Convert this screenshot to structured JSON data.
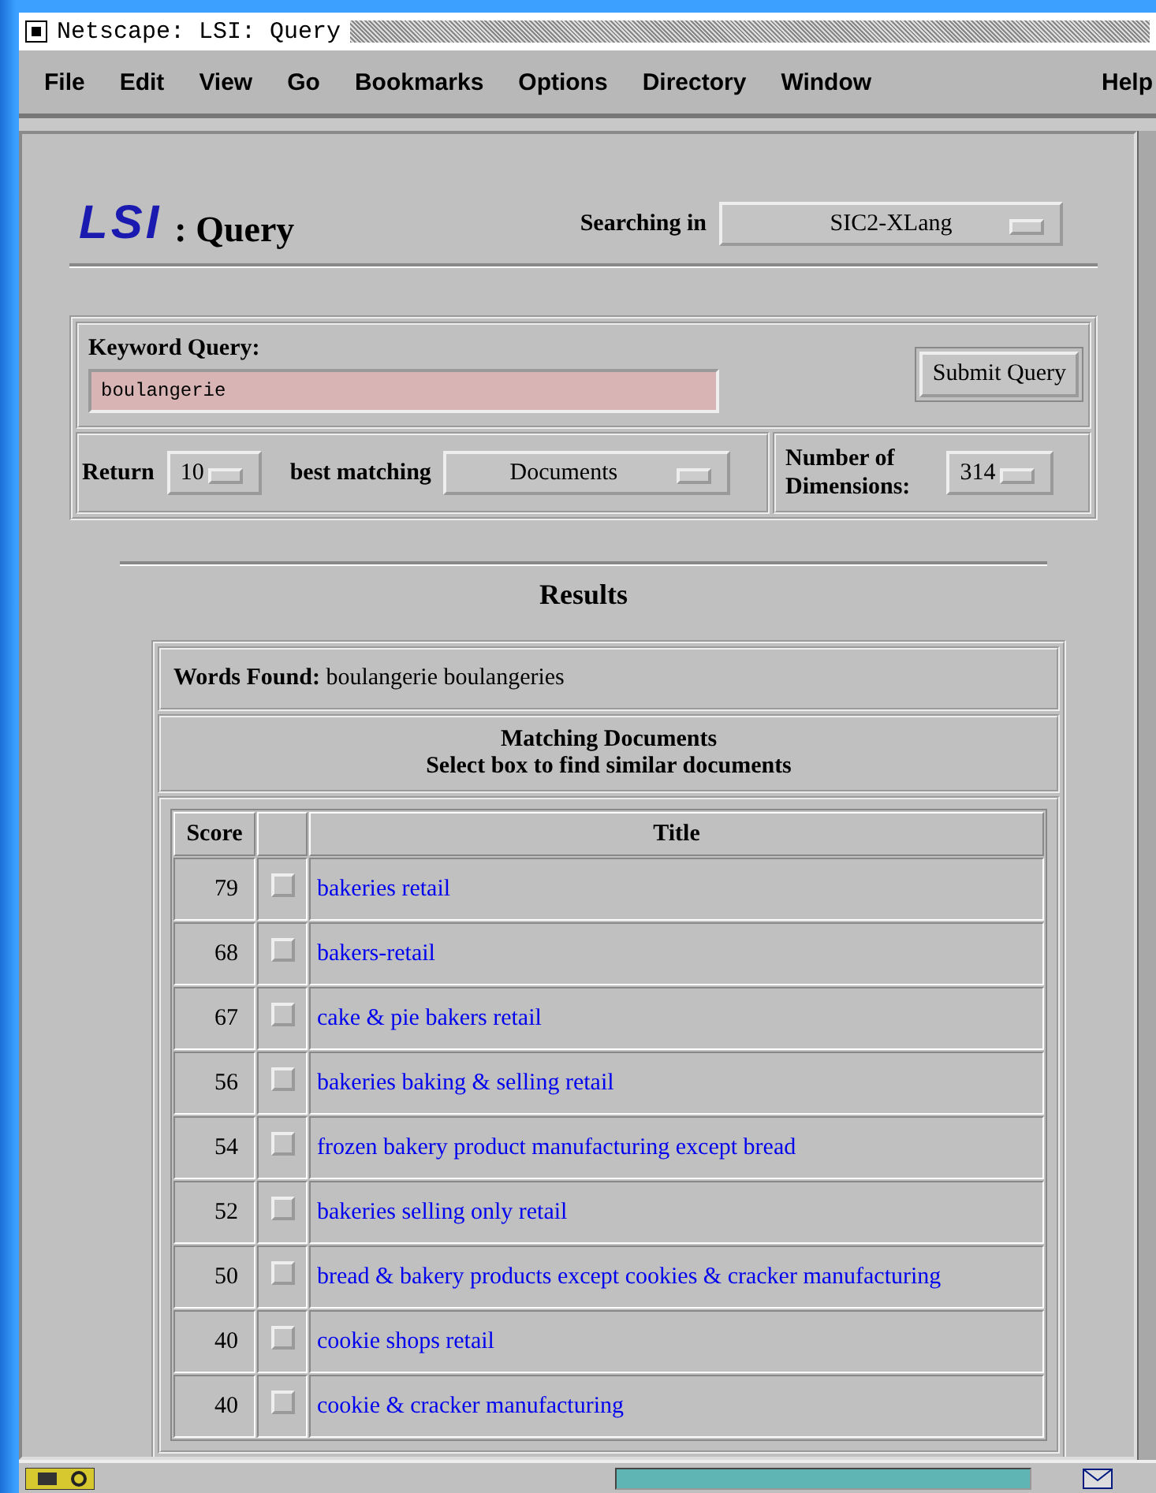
{
  "window": {
    "title": "Netscape: LSI: Query"
  },
  "menu": [
    "File",
    "Edit",
    "View",
    "Go",
    "Bookmarks",
    "Options",
    "Directory",
    "Window"
  ],
  "help_menu": "Help",
  "header": {
    "logo": "LSI",
    "title": ": Query",
    "searching_label": "Searching in",
    "database": "SIC2-XLang"
  },
  "query": {
    "label": "Keyword Query:",
    "value": "boulangerie",
    "submit": "Submit Query",
    "return_label": "Return",
    "return_count": "10",
    "matching_label": "best matching",
    "matching_type": "Documents",
    "dimensions_label": "Number of Dimensions:",
    "dimensions": "314"
  },
  "results": {
    "heading": "Results",
    "words_label": "Words Found:",
    "words": "boulangerie boulangeries",
    "matching_title": "Matching Documents",
    "matching_hint": "Select box to find similar documents",
    "columns": [
      "Score",
      "Title"
    ],
    "rows": [
      {
        "score": "79",
        "checked": false,
        "title": "bakeries retail"
      },
      {
        "score": "68",
        "checked": false,
        "title": "bakers-retail"
      },
      {
        "score": "67",
        "checked": false,
        "title": "cake & pie bakers retail"
      },
      {
        "score": "56",
        "checked": false,
        "title": "bakeries baking & selling retail"
      },
      {
        "score": "54",
        "checked": false,
        "title": "frozen bakery product manufacturing except bread"
      },
      {
        "score": "52",
        "checked": false,
        "title": "bakeries selling only retail"
      },
      {
        "score": "50",
        "checked": false,
        "title": "bread & bakery products except cookies & cracker manufacturing"
      },
      {
        "score": "40",
        "checked": false,
        "title": "cookie shops retail"
      },
      {
        "score": "40",
        "checked": false,
        "title": "cookie & cracker manufacturing"
      }
    ]
  },
  "status_bar": {
    "progress": {
      "level": 1
    }
  }
}
